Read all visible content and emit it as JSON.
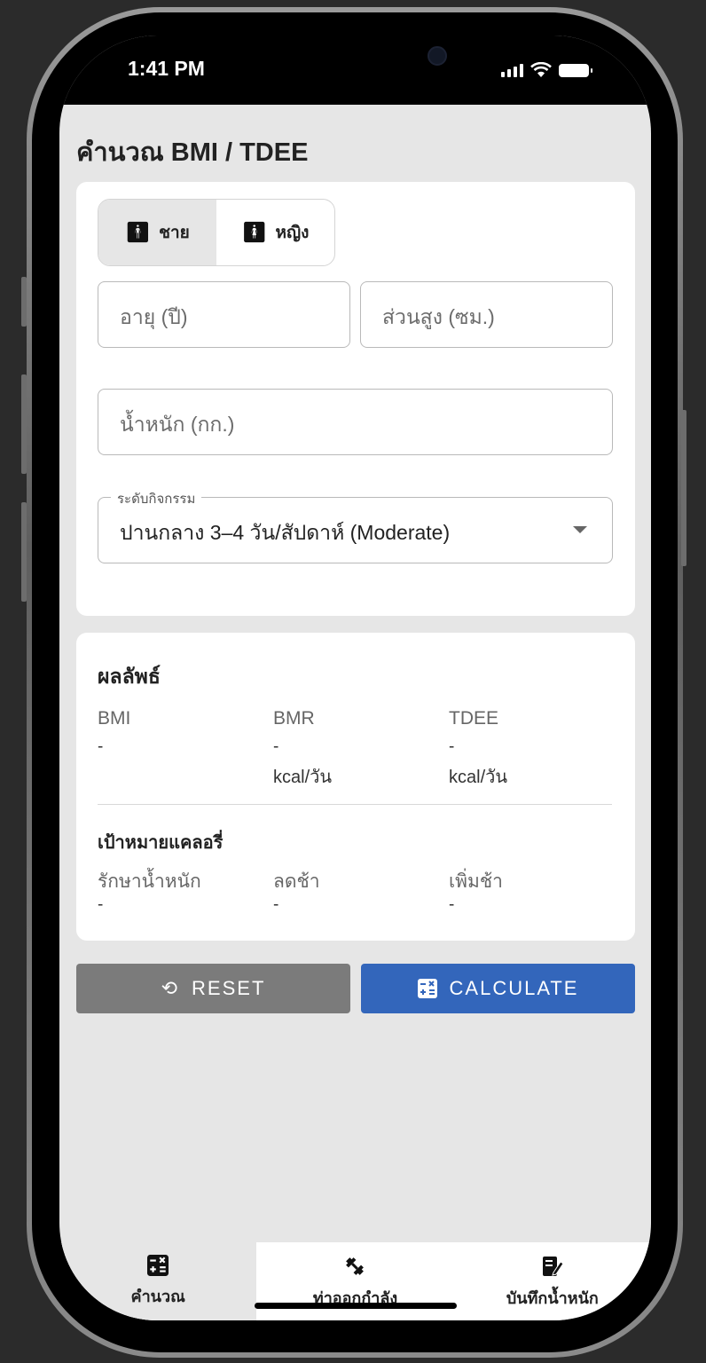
{
  "status_bar": {
    "time": "1:41 PM"
  },
  "app": {
    "title": "คำนวณ BMI / TDEE"
  },
  "form": {
    "gender_options": [
      {
        "label": "ชาย",
        "icon": "male-icon",
        "selected": true
      },
      {
        "label": "หญิง",
        "icon": "female-icon",
        "selected": false
      }
    ],
    "age_placeholder": "อายุ (ปี)",
    "height_placeholder": "ส่วนสูง (ซม.)",
    "weight_placeholder": "น้ำหนัก (กก.)",
    "activity_label": "ระดับกิจกรรม",
    "activity_value": "ปานกลาง 3–4 วัน/สัปดาห์ (Moderate)"
  },
  "results": {
    "heading": "ผลลัพธ์",
    "metrics": [
      {
        "label": "BMI",
        "value": "-",
        "unit": ""
      },
      {
        "label": "BMR",
        "value": "-",
        "unit": "kcal/วัน"
      },
      {
        "label": "TDEE",
        "value": "-",
        "unit": "kcal/วัน"
      }
    ],
    "goal_heading": "เป้าหมายแคลอรี่",
    "goals": [
      {
        "label": "รักษาน้ำหนัก",
        "value": "-"
      },
      {
        "label": "ลดช้า",
        "value": "-"
      },
      {
        "label": "เพิ่มช้า",
        "value": "-"
      }
    ]
  },
  "buttons": {
    "reset": "RESET",
    "calculate": "CALCULATE"
  },
  "bottom_nav": [
    {
      "label": "คำนวณ",
      "icon": "calculator-icon",
      "active": true
    },
    {
      "label": "ท่าออกกำลัง",
      "icon": "dumbbell-icon",
      "active": false
    },
    {
      "label": "บันทึกน้ำหนัก",
      "icon": "weight-log-icon",
      "active": false
    }
  ],
  "colors": {
    "primary": "#3366bb",
    "reset": "#7b7b7b",
    "background": "#e6e6e6"
  }
}
